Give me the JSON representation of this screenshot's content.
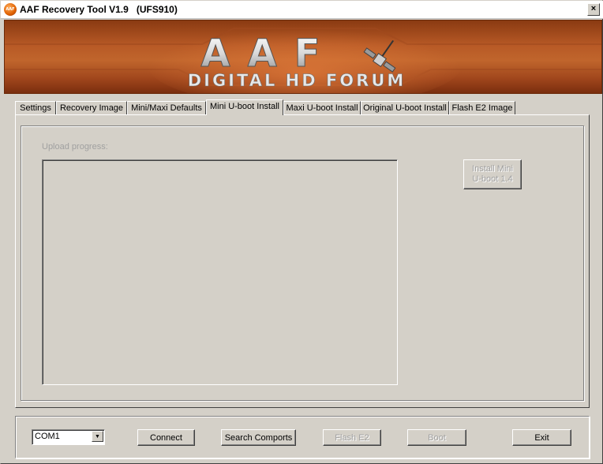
{
  "window": {
    "title": "AAF Recovery Tool V1.9   (UFS910)",
    "icon": "aaf-logo-icon",
    "icon_text": "AAF",
    "close_label": "×"
  },
  "banner": {
    "logo_text": "AAF",
    "subtitle": "DIGITAL HD FORUM",
    "colors": {
      "accent": "#b85a26",
      "dark": "#7a2e0e"
    }
  },
  "tabs": [
    {
      "label": "Settings",
      "active": false
    },
    {
      "label": "Recovery Image",
      "active": false
    },
    {
      "label": "Mini/Maxi Defaults",
      "active": false
    },
    {
      "label": "Mini U-boot Install",
      "active": true
    },
    {
      "label": "Maxi U-boot Install",
      "active": false
    },
    {
      "label": "Original U-boot Install",
      "active": false
    },
    {
      "label": "Flash E2 Image",
      "active": false
    }
  ],
  "panel": {
    "upload_label": "Upload progress:",
    "install_button": "Install Mini U-boot 1.4"
  },
  "bottom": {
    "com_port": "COM1",
    "buttons": {
      "connect": "Connect",
      "search": "Search Comports",
      "flash": "Flash E2",
      "boot": "Boot",
      "exit": "Exit"
    }
  }
}
